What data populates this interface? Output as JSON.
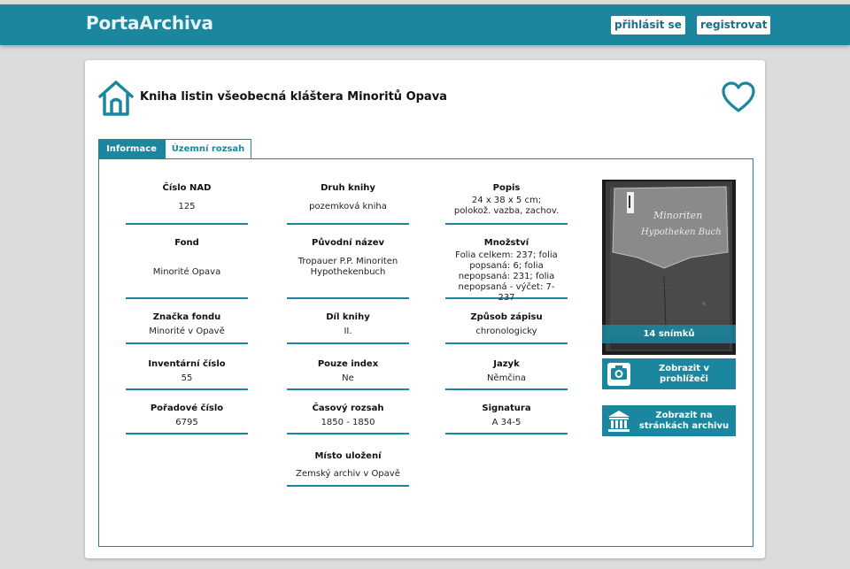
{
  "brand": "PortaArchiva",
  "nav": {
    "login": "přihlásit se",
    "register": "registrovat"
  },
  "record": {
    "title": "Kniha listin všeobecná kláštera Minoritů Opava"
  },
  "tabs": [
    "Informace",
    "Územní rozsah"
  ],
  "fields": {
    "nad": {
      "label": "Číslo NAD",
      "value": "125"
    },
    "druh": {
      "label": "Druh knihy",
      "value": "pozemková kniha"
    },
    "popis": {
      "label": "Popis",
      "value": "24 x 38 x 5 cm; polokož. vazba, zachov."
    },
    "fond": {
      "label": "Fond",
      "value": "Minorité Opava"
    },
    "puvodni": {
      "label": "Původní název",
      "value": "Tropauer P.P. Minoriten Hypothekenbuch"
    },
    "mnozstvi": {
      "label": "Množství",
      "value": "Folia celkem: 237; folia popsaná: 6; folia nepopsaná: 231; folia nepopsaná - výčet: 7-237"
    },
    "znacka": {
      "label": "Značka fondu",
      "value": "Minorité v Opavě"
    },
    "dil": {
      "label": "Díl knihy",
      "value": "II."
    },
    "zpusob": {
      "label": "Způsob zápisu",
      "value": "chronologicky"
    },
    "inventarni": {
      "label": "Inventární číslo",
      "value": "55"
    },
    "index": {
      "label": "Pouze index",
      "value": "Ne"
    },
    "jazyk": {
      "label": "Jazyk",
      "value": "Němčina"
    },
    "poradove": {
      "label": "Pořadové číslo",
      "value": "6795"
    },
    "casovy": {
      "label": "Časový rozsah",
      "value": "1850 - 1850"
    },
    "signatura": {
      "label": "Signatura",
      "value": "A 34-5"
    },
    "misto": {
      "label": "Místo uložení",
      "value": "Zemský archiv v Opavě"
    }
  },
  "thumbnail": {
    "count_label": "14 snímků",
    "cover_text": "Minoriten Hypotheken Buch"
  },
  "actions": {
    "viewer": "Zobrazit v prohlížeči",
    "archive": "Zobrazit na stránkách archivu"
  },
  "colors": {
    "accent": "#1a879f",
    "background": "#dcdcdc"
  },
  "icons": {
    "home": "home-icon",
    "favorite": "heart-icon",
    "viewer": "camera-icon",
    "archive": "institution-icon"
  }
}
